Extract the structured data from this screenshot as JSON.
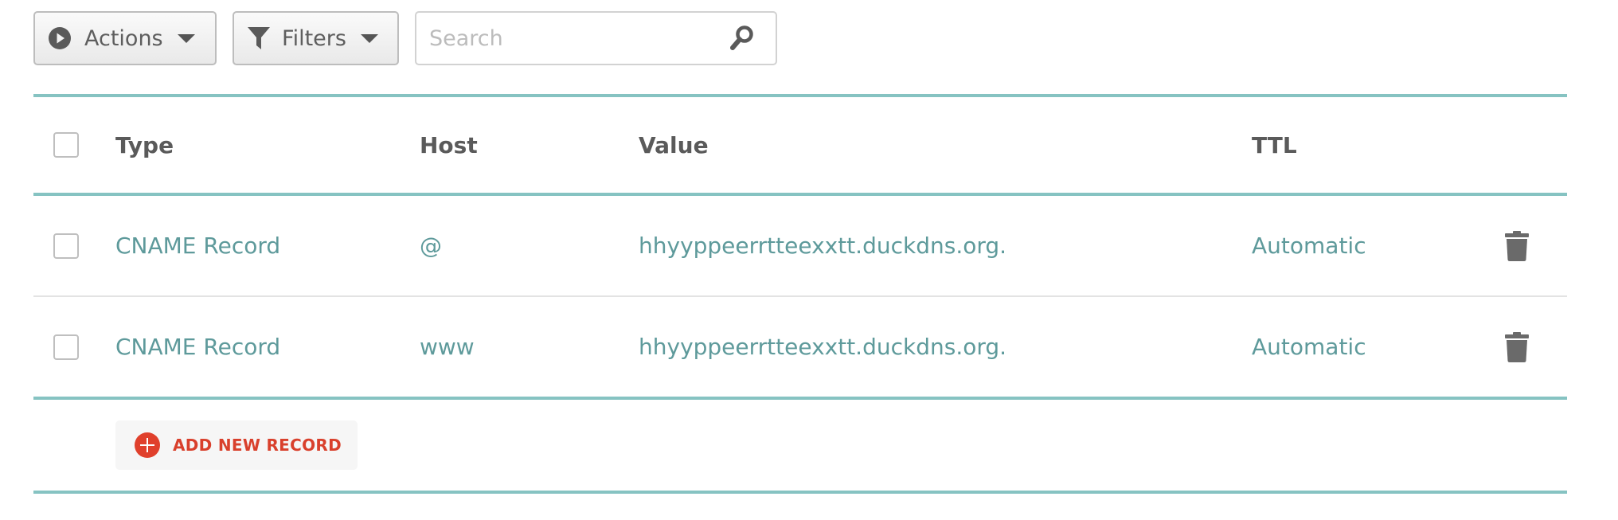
{
  "toolbar": {
    "actions_label": "Actions",
    "filters_label": "Filters",
    "search_placeholder": "Search",
    "search_value": ""
  },
  "table": {
    "columns": [
      "Type",
      "Host",
      "Value",
      "TTL"
    ],
    "rows": [
      {
        "type": "CNAME Record",
        "host": "@",
        "value": "hhyyppeerrtteexxtt.duckdns.org.",
        "ttl": "Automatic"
      },
      {
        "type": "CNAME Record",
        "host": "www",
        "value": "hhyyppeerrtteexxtt.duckdns.org.",
        "ttl": "Automatic"
      }
    ],
    "add_label": "ADD NEW RECORD"
  },
  "icons": {
    "actions": "play-circle-icon",
    "filters": "funnel-icon",
    "search": "search-icon",
    "delete": "trash-icon",
    "add": "plus-circle-icon"
  },
  "colors": {
    "accent_teal": "#86c3c2",
    "link_text": "#5e9a9b",
    "add_red": "#d9402c"
  }
}
